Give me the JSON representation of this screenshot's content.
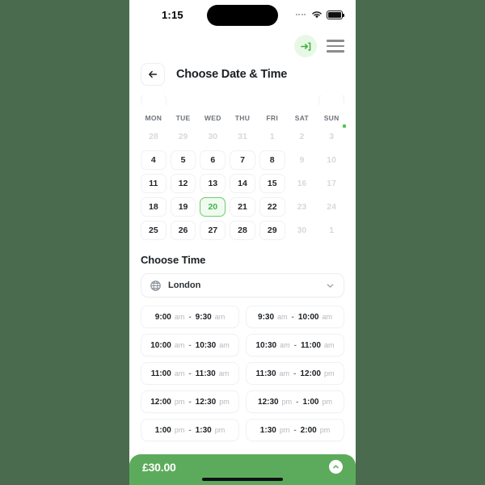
{
  "status_bar": {
    "time": "1:15",
    "wifi_icon": "wifi-icon",
    "battery_icon": "battery-icon",
    "signal_dots_icon": "signal-dots-icon"
  },
  "app_header": {
    "login_icon": "login-arrow-icon",
    "menu_icon": "hamburger-menu-icon"
  },
  "title_bar": {
    "back_icon": "arrow-left-icon",
    "title": "Choose Date & Time"
  },
  "calendar": {
    "weekdays": [
      "MON",
      "TUE",
      "WED",
      "THU",
      "FRI",
      "SAT",
      "SUN"
    ],
    "selected_day": "20",
    "selected_color": "#43b248",
    "selected_border": "#6ecb6e",
    "selected_bg": "#f0fbef",
    "indicator_dot_color": "#4dc44d",
    "rows": [
      [
        {
          "label": "28",
          "state": "muted"
        },
        {
          "label": "29",
          "state": "muted"
        },
        {
          "label": "30",
          "state": "muted"
        },
        {
          "label": "31",
          "state": "muted"
        },
        {
          "label": "1",
          "state": "muted"
        },
        {
          "label": "2",
          "state": "muted"
        },
        {
          "label": "3",
          "state": "muted",
          "dot": true
        }
      ],
      [
        {
          "label": "4",
          "state": "available"
        },
        {
          "label": "5",
          "state": "available"
        },
        {
          "label": "6",
          "state": "available"
        },
        {
          "label": "7",
          "state": "available"
        },
        {
          "label": "8",
          "state": "available"
        },
        {
          "label": "9",
          "state": "muted"
        },
        {
          "label": "10",
          "state": "muted"
        }
      ],
      [
        {
          "label": "11",
          "state": "available"
        },
        {
          "label": "12",
          "state": "available"
        },
        {
          "label": "13",
          "state": "available"
        },
        {
          "label": "14",
          "state": "available"
        },
        {
          "label": "15",
          "state": "available"
        },
        {
          "label": "16",
          "state": "muted"
        },
        {
          "label": "17",
          "state": "muted"
        }
      ],
      [
        {
          "label": "18",
          "state": "available"
        },
        {
          "label": "19",
          "state": "available"
        },
        {
          "label": "20",
          "state": "selected"
        },
        {
          "label": "21",
          "state": "available"
        },
        {
          "label": "22",
          "state": "available"
        },
        {
          "label": "23",
          "state": "muted"
        },
        {
          "label": "24",
          "state": "muted"
        }
      ],
      [
        {
          "label": "25",
          "state": "available"
        },
        {
          "label": "26",
          "state": "available"
        },
        {
          "label": "27",
          "state": "available"
        },
        {
          "label": "28",
          "state": "available"
        },
        {
          "label": "29",
          "state": "available"
        },
        {
          "label": "30",
          "state": "muted"
        },
        {
          "label": "1",
          "state": "muted"
        }
      ]
    ]
  },
  "time_section": {
    "heading": "Choose Time",
    "timezone": {
      "globe_icon": "globe-icon",
      "value": "London",
      "chevron_icon": "chevron-down-icon"
    },
    "separator": "-",
    "slots": [
      {
        "start": "9:00",
        "start_mer": "am",
        "end": "9:30",
        "end_mer": "am"
      },
      {
        "start": "9:30",
        "start_mer": "am",
        "end": "10:00",
        "end_mer": "am"
      },
      {
        "start": "10:00",
        "start_mer": "am",
        "end": "10:30",
        "end_mer": "am"
      },
      {
        "start": "10:30",
        "start_mer": "am",
        "end": "11:00",
        "end_mer": "am"
      },
      {
        "start": "11:00",
        "start_mer": "am",
        "end": "11:30",
        "end_mer": "am"
      },
      {
        "start": "11:30",
        "start_mer": "am",
        "end": "12:00",
        "end_mer": "pm"
      },
      {
        "start": "12:00",
        "start_mer": "pm",
        "end": "12:30",
        "end_mer": "pm"
      },
      {
        "start": "12:30",
        "start_mer": "pm",
        "end": "1:00",
        "end_mer": "pm"
      },
      {
        "start": "1:00",
        "start_mer": "pm",
        "end": "1:30",
        "end_mer": "pm"
      },
      {
        "start": "1:30",
        "start_mer": "pm",
        "end": "2:00",
        "end_mer": "pm"
      }
    ]
  },
  "bottom_bar": {
    "price": "£30.00",
    "expand_icon": "chevron-up-icon",
    "bar_color": "#5cab5c",
    "home_indicator": "home-indicator"
  },
  "page": {
    "backdrop_color": "#4a6b4d"
  }
}
